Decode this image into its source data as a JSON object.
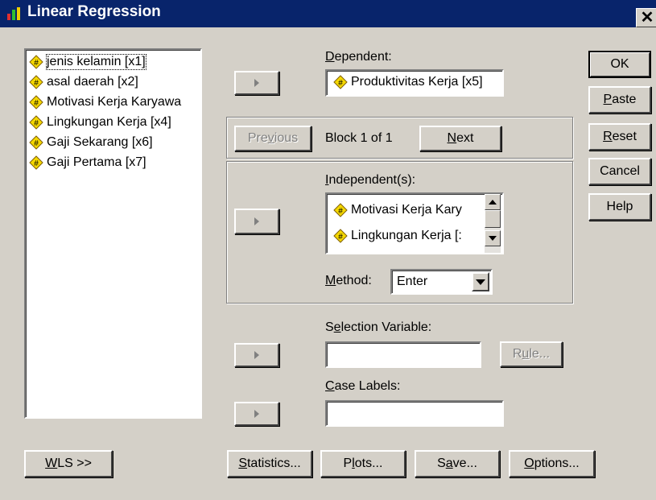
{
  "window": {
    "title": "Linear Regression",
    "close_glyph": "✕"
  },
  "source_list": {
    "items": [
      {
        "label": "jenis kelamin [x1]",
        "icon": "scale-var-icon"
      },
      {
        "label": "asal daerah [x2]",
        "icon": "scale-var-icon"
      },
      {
        "label": "Motivasi Kerja Karyawa",
        "icon": "scale-var-icon"
      },
      {
        "label": "Lingkungan Kerja [x4]",
        "icon": "scale-var-icon"
      },
      {
        "label": "Gaji Sekarang [x6]",
        "icon": "scale-var-icon"
      },
      {
        "label": "Gaji Pertama [x7]",
        "icon": "scale-var-icon"
      }
    ]
  },
  "dependent": {
    "label_ul": "D",
    "label_rest": "ependent:",
    "value": "Produktivitas Kerja [x5]"
  },
  "block": {
    "previous_label_pre": "Pre",
    "previous_label_ul": "v",
    "previous_label_post": "ious",
    "text": "Block 1 of 1",
    "next_label_ul": "N",
    "next_label_rest": "ext"
  },
  "independents": {
    "label_ul": "I",
    "label_rest": "ndependent(s):",
    "items": [
      {
        "label": "Motivasi Kerja Kary"
      },
      {
        "label": "Lingkungan Kerja [:"
      }
    ]
  },
  "method": {
    "label_ul": "M",
    "label_rest": "ethod:",
    "value": "Enter"
  },
  "selection": {
    "label_pre": "S",
    "label_ul": "e",
    "label_rest": "lection Variable:",
    "value": "",
    "rule_pre": "R",
    "rule_ul": "u",
    "rule_rest": "le..."
  },
  "case_labels": {
    "label_ul": "C",
    "label_rest": "ase Labels:",
    "value": ""
  },
  "side_buttons": {
    "ok": "OK",
    "paste_ul": "P",
    "paste_rest": "aste",
    "reset_ul": "R",
    "reset_rest": "eset",
    "cancel": "Cancel",
    "help": "Help"
  },
  "bottom_buttons": {
    "wls_ul": "W",
    "wls_rest": "LS >>",
    "statistics_ul": "S",
    "statistics_rest": "tatistics...",
    "plots_pre": "P",
    "plots_ul": "l",
    "plots_rest": "ots...",
    "save_pre": "S",
    "save_ul": "a",
    "save_rest": "ve...",
    "options_ul": "O",
    "options_rest": "ptions..."
  },
  "colors": {
    "titlebar": "#08246b",
    "dialog_bg": "#d4d0c8",
    "var_icon_fill": "#f5d800"
  }
}
